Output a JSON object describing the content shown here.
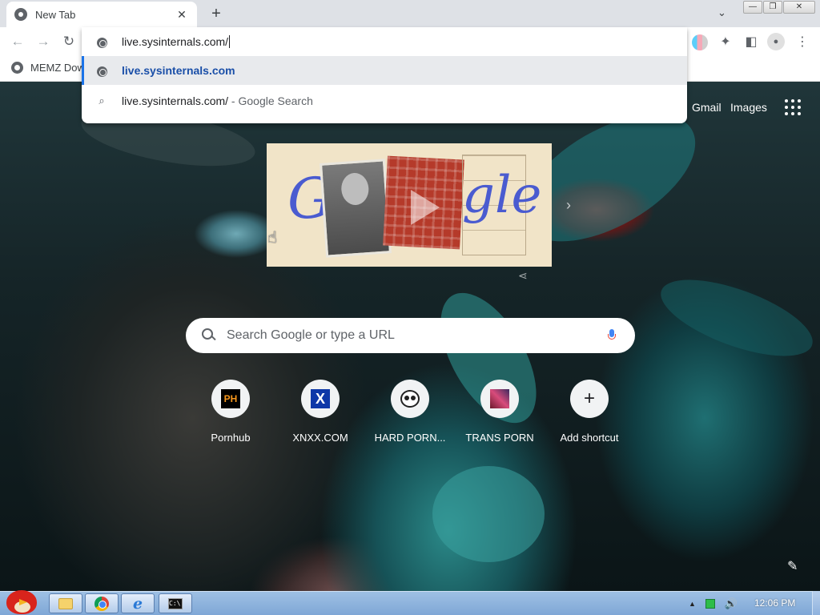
{
  "browser": {
    "tab_title": "New Tab",
    "tab_close": "✕",
    "new_tab": "+",
    "tab_search": "⌄",
    "window_minimize": "—",
    "window_maximize": "❐",
    "window_close": "✕"
  },
  "toolbar": {
    "back": "←",
    "forward": "→",
    "reload": "↻",
    "extensions": "✦",
    "side_panel": "◧",
    "profile": "●",
    "menu": "⋮"
  },
  "bookmarks": [
    {
      "label": "MEMZ Dow"
    }
  ],
  "omnibox": {
    "typed_text": "live.sysinternals.com/",
    "suggestions": [
      {
        "text": "live.sysinternals.com",
        "kind": "url",
        "selected": true
      },
      {
        "text": "live.sysinternals.com/",
        "suffix": " - Google Search",
        "kind": "search",
        "selected": false
      }
    ]
  },
  "ntp": {
    "gmail": "Gmail",
    "images": "Images",
    "search_placeholder": "Search Google or type a URL",
    "doodle_next": "›",
    "doodle_share": "⋖",
    "edit": "✎",
    "shortcuts": [
      {
        "label": "Pornhub",
        "icon": "ph-icon",
        "icon_text": "PH"
      },
      {
        "label": "XNXX.COM",
        "icon": "x-icon",
        "icon_text": "X"
      },
      {
        "label": "HARD PORN...",
        "icon": "panda-icon",
        "icon_text": ""
      },
      {
        "label": "TRANS PORN",
        "icon": "trans-icon",
        "icon_text": ""
      },
      {
        "label": "Add shortcut",
        "icon": "plus-icon",
        "icon_text": "+"
      }
    ]
  },
  "taskbar": {
    "cmd_icon_text": "C:\\",
    "tray_up": "▲",
    "volume": "🔊",
    "clock": "12:06 PM"
  },
  "colors": {
    "accent": "#1a73e8",
    "suggestion_text": "#1a4fa8",
    "taskbar": "#7fa7d6"
  }
}
